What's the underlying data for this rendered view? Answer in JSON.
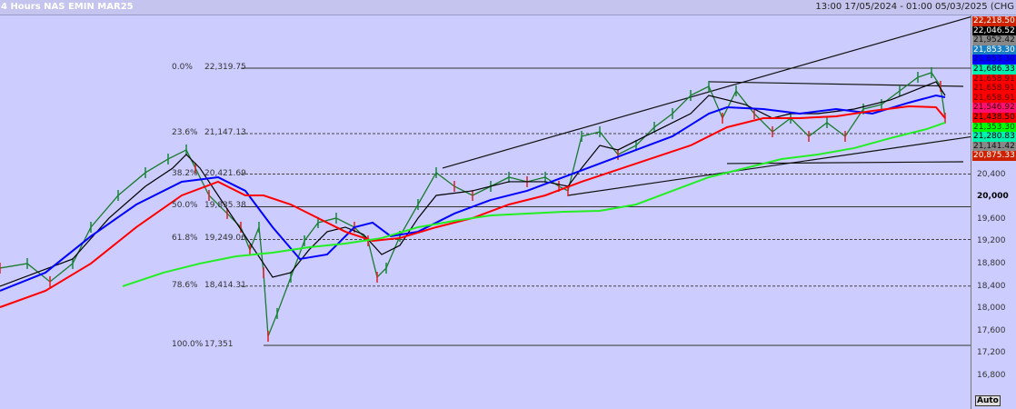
{
  "header": {
    "title": "4 Hours NAS EMIN MAR25",
    "range": "13:00 17/05/2024 - 01:00 05/03/2025 (CHG"
  },
  "axis": {
    "auto_label": "Auto",
    "ticks": [
      "20,400",
      "20,000",
      "19,600",
      "19,200",
      "18,800",
      "18,400",
      "18,000",
      "17,600",
      "17,200",
      "16,800"
    ],
    "tick_values": [
      20400,
      20000,
      19600,
      19200,
      18800,
      18400,
      18000,
      17600,
      17200,
      16800
    ],
    "bold_tick": "20,000"
  },
  "badges": [
    {
      "label": "22,218.50",
      "bg": "#cc2200",
      "fg": "#ffffff"
    },
    {
      "label": "22,046.52",
      "bg": "#000000",
      "fg": "#ffffff"
    },
    {
      "label": "21,952.42",
      "bg": "#888888",
      "fg": "#111111"
    },
    {
      "label": "21,853.30",
      "bg": "#1a7fc0",
      "fg": "#ffffff"
    },
    {
      "label": "21,853.30",
      "bg": "#0000ff",
      "fg": "#000088"
    },
    {
      "label": "21,686.33",
      "bg": "#00f0b0",
      "fg": "#000000"
    },
    {
      "label": "21,658.91",
      "bg": "#ff0000",
      "fg": "#550000"
    },
    {
      "label": "21,658.91",
      "bg": "#ff0000",
      "fg": "#550000"
    },
    {
      "label": "21,658.91",
      "bg": "#ff0000",
      "fg": "#550000"
    },
    {
      "label": "21,546.92",
      "bg": "#ff1070",
      "fg": "#440000"
    },
    {
      "label": "21,438.50",
      "bg": "#ff0000",
      "fg": "#000000"
    },
    {
      "label": "21,353.30",
      "bg": "#00ff00",
      "fg": "#003300"
    },
    {
      "label": "21,280.83",
      "bg": "#00f0b0",
      "fg": "#000000"
    },
    {
      "label": "21,141.42",
      "bg": "#888888",
      "fg": "#111111"
    },
    {
      "label": "20,875.33",
      "bg": "#cc2200",
      "fg": "#ffffff"
    }
  ],
  "chart_data": {
    "type": "line",
    "title": "4 Hours NAS EMIN MAR25",
    "ylim": [
      16500,
      22700
    ],
    "xlim": [
      0,
      107
    ],
    "fib_levels": [
      {
        "pct": "0.0%",
        "price": "22,319.75",
        "value": 22319.75,
        "style": "solid"
      },
      {
        "pct": "23.6%",
        "price": "21,147.13",
        "value": 21147.13,
        "style": "dashed"
      },
      {
        "pct": "38.2%",
        "price": "20,421.69",
        "value": 20421.69,
        "style": "dashed"
      },
      {
        "pct": "50.0%",
        "price": "19,835.38",
        "value": 19835.38,
        "style": "solid"
      },
      {
        "pct": "61.8%",
        "price": "19,249.06",
        "value": 19249.06,
        "style": "dashed"
      },
      {
        "pct": "78.6%",
        "price": "18,414.31",
        "value": 18414.31,
        "style": "dashed"
      },
      {
        "pct": "100.0%",
        "price": "17,351",
        "value": 17351,
        "style": "solid"
      }
    ],
    "series": [
      {
        "name": "price",
        "color": "#1a7a2a",
        "x": [
          0,
          3,
          5.5,
          8,
          10,
          13,
          16,
          18.5,
          20.5,
          21.5,
          23,
          25,
          26.5,
          27.5,
          28.5,
          29,
          29.5,
          30.5,
          32,
          33.5,
          35,
          37,
          39,
          40.5,
          41.5,
          42.5,
          44,
          46,
          48,
          50,
          52,
          54,
          56,
          58,
          60,
          61.5,
          62.5,
          64,
          66,
          68,
          70,
          72,
          74,
          76,
          78,
          79.5,
          81,
          83,
          85,
          87,
          89,
          91,
          93,
          95,
          97,
          99,
          101,
          102.5,
          103.5,
          104
        ],
        "y": [
          18736,
          18818,
          18492,
          18818,
          19469,
          20039,
          20447,
          20691,
          20854,
          20528,
          20039,
          19714,
          19469,
          19062,
          19469,
          18655,
          17514,
          17922,
          18573,
          19225,
          19551,
          19632,
          19469,
          19225,
          18573,
          18736,
          19306,
          19876,
          20447,
          20202,
          20039,
          20202,
          20365,
          20284,
          20365,
          20202,
          20121,
          21098,
          21180,
          20772,
          20935,
          21261,
          21505,
          21831,
          21994,
          21424,
          21913,
          21505,
          21180,
          21424,
          21098,
          21343,
          21098,
          21587,
          21668,
          21913,
          22157,
          22239,
          21994,
          21424
        ]
      },
      {
        "name": "ma-fast",
        "color": "#000000",
        "x": [
          0,
          4,
          8,
          12,
          16,
          19,
          20.5,
          22,
          24,
          26,
          28,
          30,
          32,
          34,
          36,
          38,
          40,
          42,
          44,
          46,
          48,
          52,
          56,
          60,
          62.5,
          64,
          66,
          68,
          72,
          76,
          78,
          80,
          82,
          85,
          87,
          90,
          94,
          98,
          101,
          103,
          104
        ],
        "y": [
          18410,
          18655,
          18899,
          19632,
          20202,
          20528,
          20772,
          20528,
          20039,
          19551,
          19062,
          18573,
          18655,
          19062,
          19388,
          19469,
          19339,
          18980,
          19143,
          19632,
          20039,
          20121,
          20284,
          20284,
          20202,
          20528,
          20935,
          20854,
          21180,
          21505,
          21831,
          21750,
          21668,
          21424,
          21505,
          21505,
          21587,
          21750,
          21946,
          22076,
          21831
        ]
      },
      {
        "name": "ma-mid",
        "color": "#0000ff",
        "x": [
          0,
          5,
          10,
          15,
          20,
          24,
          27,
          30,
          33,
          36,
          39,
          41,
          43,
          46,
          50,
          54,
          58,
          62,
          66,
          70,
          74,
          78,
          80,
          84,
          88,
          92,
          96,
          100,
          103,
          104
        ],
        "y": [
          18329,
          18655,
          19306,
          19876,
          20284,
          20365,
          20121,
          19469,
          18899,
          18980,
          19469,
          19551,
          19306,
          19388,
          19714,
          19958,
          20121,
          20365,
          20610,
          20854,
          21098,
          21505,
          21619,
          21587,
          21505,
          21587,
          21505,
          21701,
          21831,
          21799
        ]
      },
      {
        "name": "ma-slow",
        "color": "#ff0000",
        "x": [
          0,
          5,
          10,
          15,
          20,
          24,
          27,
          29,
          32,
          35,
          38,
          41,
          44,
          48,
          52,
          56,
          60,
          64,
          70,
          76,
          80,
          84,
          88,
          92,
          96,
          100,
          103,
          104
        ],
        "y": [
          18035,
          18329,
          18818,
          19469,
          20039,
          20284,
          20039,
          20039,
          19876,
          19632,
          19388,
          19225,
          19274,
          19469,
          19632,
          19876,
          20039,
          20284,
          20610,
          20935,
          21261,
          21424,
          21424,
          21457,
          21554,
          21636,
          21619,
          21424
        ]
      },
      {
        "name": "ma-long",
        "color": "#22ee22",
        "x": [
          13.5,
          18,
          22,
          26,
          30,
          34,
          38,
          42,
          46,
          50,
          54,
          58,
          62,
          66,
          70,
          74,
          78,
          82,
          86,
          90,
          94,
          98,
          102,
          104
        ],
        "y": [
          18410,
          18655,
          18818,
          18948,
          19013,
          19111,
          19176,
          19274,
          19469,
          19583,
          19681,
          19714,
          19746,
          19762,
          19876,
          20121,
          20365,
          20528,
          20691,
          20772,
          20887,
          21066,
          21229,
          21343
        ]
      }
    ],
    "trend_lines": [
      {
        "x": [
          48.7,
          107
        ],
        "y": [
          20528,
          23248
        ]
      },
      {
        "x": [
          62.5,
          112
        ],
        "y": [
          20039,
          21212
        ]
      },
      {
        "x": [
          80,
          106
        ],
        "y": [
          20610,
          20642
        ]
      },
      {
        "x": [
          78,
          106
        ],
        "y": [
          22076,
          21994
        ]
      }
    ]
  }
}
